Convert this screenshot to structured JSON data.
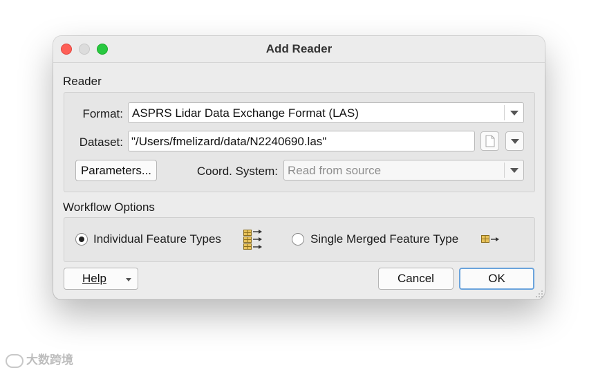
{
  "window": {
    "title": "Add Reader"
  },
  "reader": {
    "section_label": "Reader",
    "format_label": "Format:",
    "format_value": "ASPRS Lidar Data Exchange Format (LAS)",
    "dataset_label": "Dataset:",
    "dataset_value": "\"/Users/fmelizard/data/N2240690.las\"",
    "parameters_label": "Parameters...",
    "coord_label": "Coord. System:",
    "coord_placeholder": "Read from source"
  },
  "workflow": {
    "section_label": "Workflow Options",
    "options": [
      {
        "label": "Individual Feature Types",
        "selected": true
      },
      {
        "label": "Single Merged Feature Type",
        "selected": false
      }
    ]
  },
  "buttons": {
    "help": "Help",
    "cancel": "Cancel",
    "ok": "OK"
  },
  "watermark": {
    "text": "大数跨境"
  },
  "colors": {
    "close": "#fe5f57",
    "maximize": "#28c840",
    "default_button_border": "#6aa3dc",
    "feature_icon": "#b8860b"
  }
}
